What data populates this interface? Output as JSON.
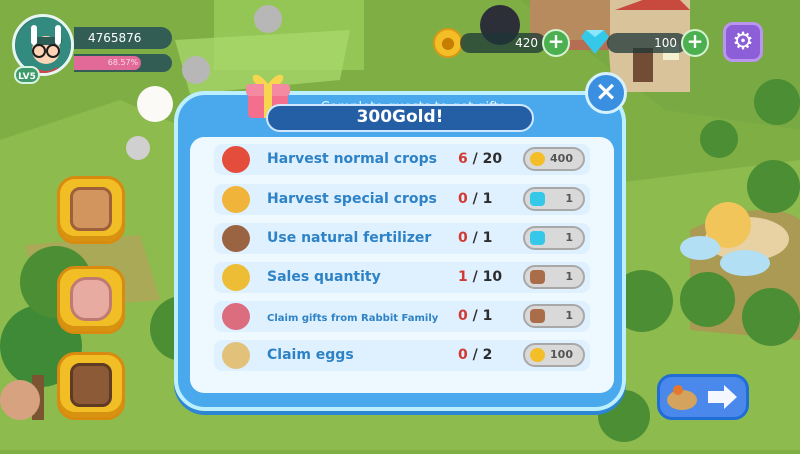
{
  "hud": {
    "gold_count": "4765876",
    "exp_percent": "68.57%",
    "exp_fraction": 0.6857,
    "level": "LV5",
    "coin_balance": "420",
    "gem_balance": "100"
  },
  "dialog": {
    "header": "Complete quests to get gifts",
    "title": "300Gold!"
  },
  "quests": [
    {
      "label": "Harvest normal crops",
      "current": "6",
      "total": "20",
      "reward_value": "400",
      "reward_icon": "gold-coin-icon",
      "quest_icon": "tomato-icon"
    },
    {
      "label": "Harvest special crops",
      "current": "0",
      "total": "1",
      "reward_value": "1",
      "reward_icon": "diamond-icon",
      "quest_icon": "special-crops-icon"
    },
    {
      "label": "Use natural fertilizer",
      "current": "0",
      "total": "1",
      "reward_value": "1",
      "reward_icon": "diamond-icon",
      "quest_icon": "fertilizer-icon"
    },
    {
      "label": "Sales quantity",
      "current": "1",
      "total": "10",
      "reward_value": "1",
      "reward_icon": "fertilizer-icon",
      "quest_icon": "sales-icon"
    },
    {
      "label": "Claim gifts from Rabbit Family",
      "current": "0",
      "total": "1",
      "reward_value": "1",
      "reward_icon": "fertilizer-icon",
      "quest_icon": "rabbit-family-icon"
    },
    {
      "label": "Claim eggs",
      "current": "0",
      "total": "2",
      "reward_value": "100",
      "reward_icon": "gold-coin-icon",
      "quest_icon": "eggs-icon"
    }
  ],
  "colors": {
    "dialog_blue": "#4aa9ec",
    "quest_text": "#2e82c6",
    "progress_red": "#d03a33",
    "coin_gold": "#f3be27",
    "settings_purple": "#8c5ed7"
  },
  "side_buttons": [
    {
      "icon": "quest-list-icon"
    },
    {
      "icon": "backpack-icon"
    },
    {
      "icon": "market-stall-icon"
    }
  ]
}
